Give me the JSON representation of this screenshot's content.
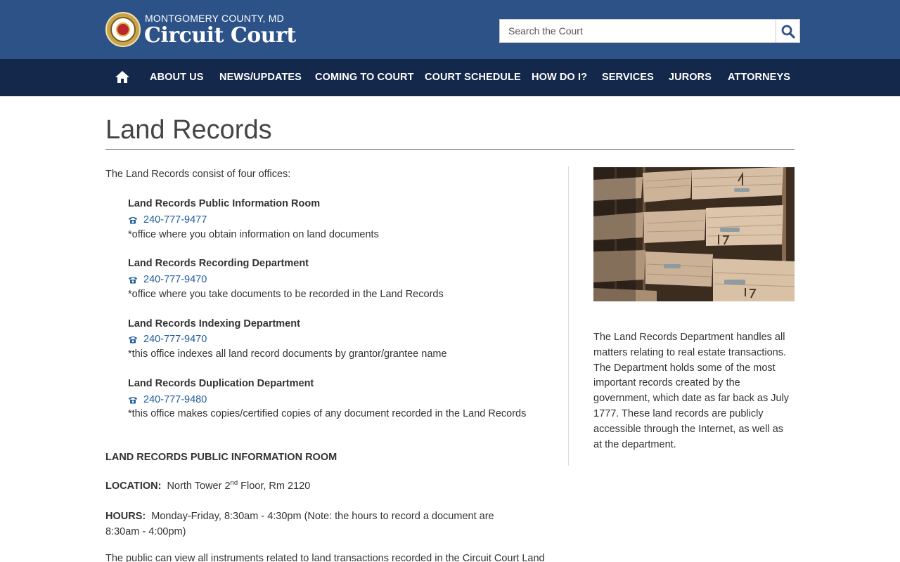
{
  "header": {
    "county": "MONTGOMERY COUNTY, MD",
    "title": "Circuit Court",
    "search_placeholder": "Search the Court",
    "logo_icon": "county-seal-logo",
    "search_icon": "magnifier-icon",
    "bg_color": "#2c5288"
  },
  "nav": {
    "bg_color": "#13284a",
    "home_icon": "home-icon",
    "items": [
      {
        "label": "ABOUT US"
      },
      {
        "label": "NEWS/UPDATES"
      },
      {
        "label": "COMING TO COURT"
      },
      {
        "label": "COURT SCHEDULE"
      },
      {
        "label": "HOW DO I?"
      },
      {
        "label": "SERVICES"
      },
      {
        "label": "JURORS"
      },
      {
        "label": "ATTORNEYS"
      }
    ]
  },
  "main": {
    "title": "Land Records",
    "intro": "The Land Records consist of four offices:",
    "phone_icon": "telephone-icon",
    "link_color": "#1f5b9d",
    "offices": [
      {
        "name": "Land Records Public Information Room",
        "phone": "240-777-9477",
        "note": "*office where you obtain information on land documents"
      },
      {
        "name": "Land Records Recording Department",
        "phone": "240-777-9470",
        "note": "*office where you take documents to be recorded in the Land Records"
      },
      {
        "name": "Land Records Indexing Department",
        "phone": "240-777-9470",
        "note": "*this office indexes all land record documents by grantor/grantee name"
      },
      {
        "name": "Land Records Duplication Department",
        "phone": "240-777-9480",
        "note": "*this office makes copies/certified copies of any document recorded in the Land Records"
      }
    ],
    "section_heading": "LAND RECORDS PUBLIC INFORMATION ROOM",
    "location_label": "LOCATION:",
    "location_pre": "North Tower 2",
    "location_sup": "nd",
    "location_post": " Floor, Rm 2120",
    "hours_label": "HOURS:",
    "hours_text": "Monday-Friday, 8:30am - 4:30pm (Note: the hours to record a document are 8:30am - 4:00pm)",
    "partial_paragraph": "The public can view all instruments related to land transactions recorded in the Circuit Court Land"
  },
  "sidebar": {
    "image_alt": "stacked land record binders",
    "text": "The Land Records Department handles all matters relating to real estate transactions. The Department holds some of the most important records created by the government, which date as far back as July 1777. These land records are publicly accessible through the Internet, as well as at the department."
  }
}
